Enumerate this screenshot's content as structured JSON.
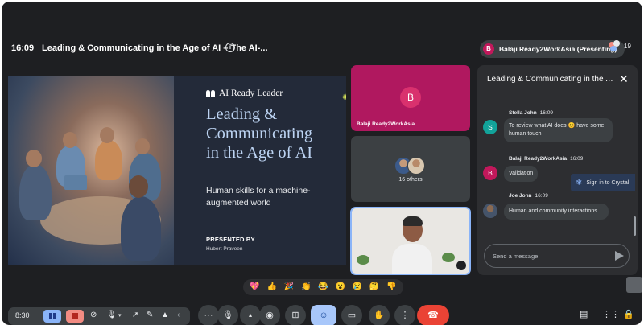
{
  "header": {
    "time": "16:09",
    "meeting_title": "Leading & Communicating in the Age of AI – The AI-...",
    "presenter_avatar": "B",
    "presenter_label": "Balaji Ready2WorkAsia (Presenting)",
    "participant_count": "19"
  },
  "slide": {
    "brand": "AI Ready Leader",
    "headline": "Leading &\nCommunicating\nin the Age of AI",
    "subtitle": "Human skills for a machine-\naugmented world",
    "presented_by": "PRESENTED BY",
    "presenter_name": "Hubert Praveen"
  },
  "tiles": {
    "balaji": {
      "avatar": "B",
      "name": "Balaji Ready2WorkAsia",
      "color": "#b0185f"
    },
    "others": {
      "label": "16 others"
    }
  },
  "chat": {
    "title": "Leading & Communicating in the Age of AI",
    "messages": [
      {
        "sender": "Stella John",
        "time": "16:09",
        "avatar": "S",
        "avatar_color": "#12a39a",
        "text": "To review what AI does 😊 have some human touch"
      },
      {
        "sender": "Balaji Ready2WorkAsia",
        "time": "16:09",
        "avatar": "B",
        "avatar_color": "#c2185b",
        "text": "Validation"
      },
      {
        "sender": "Joe John",
        "time": "16:09",
        "avatar": "",
        "avatar_color": "#5f6368",
        "text": "Human and community interactions"
      }
    ],
    "input_placeholder": "Send a message",
    "crystal_label": "Sign in to Crystal"
  },
  "reactions": [
    "💖",
    "👍",
    "🎉",
    "👏",
    "😂",
    "😮",
    "😢",
    "🤔",
    "👎"
  ],
  "bottom": {
    "recording_time": "8:30"
  },
  "colors": {
    "background": "#1e1f22",
    "panel": "#2d2e31",
    "accent": "#8ab4f8",
    "end_call": "#ea4335"
  }
}
